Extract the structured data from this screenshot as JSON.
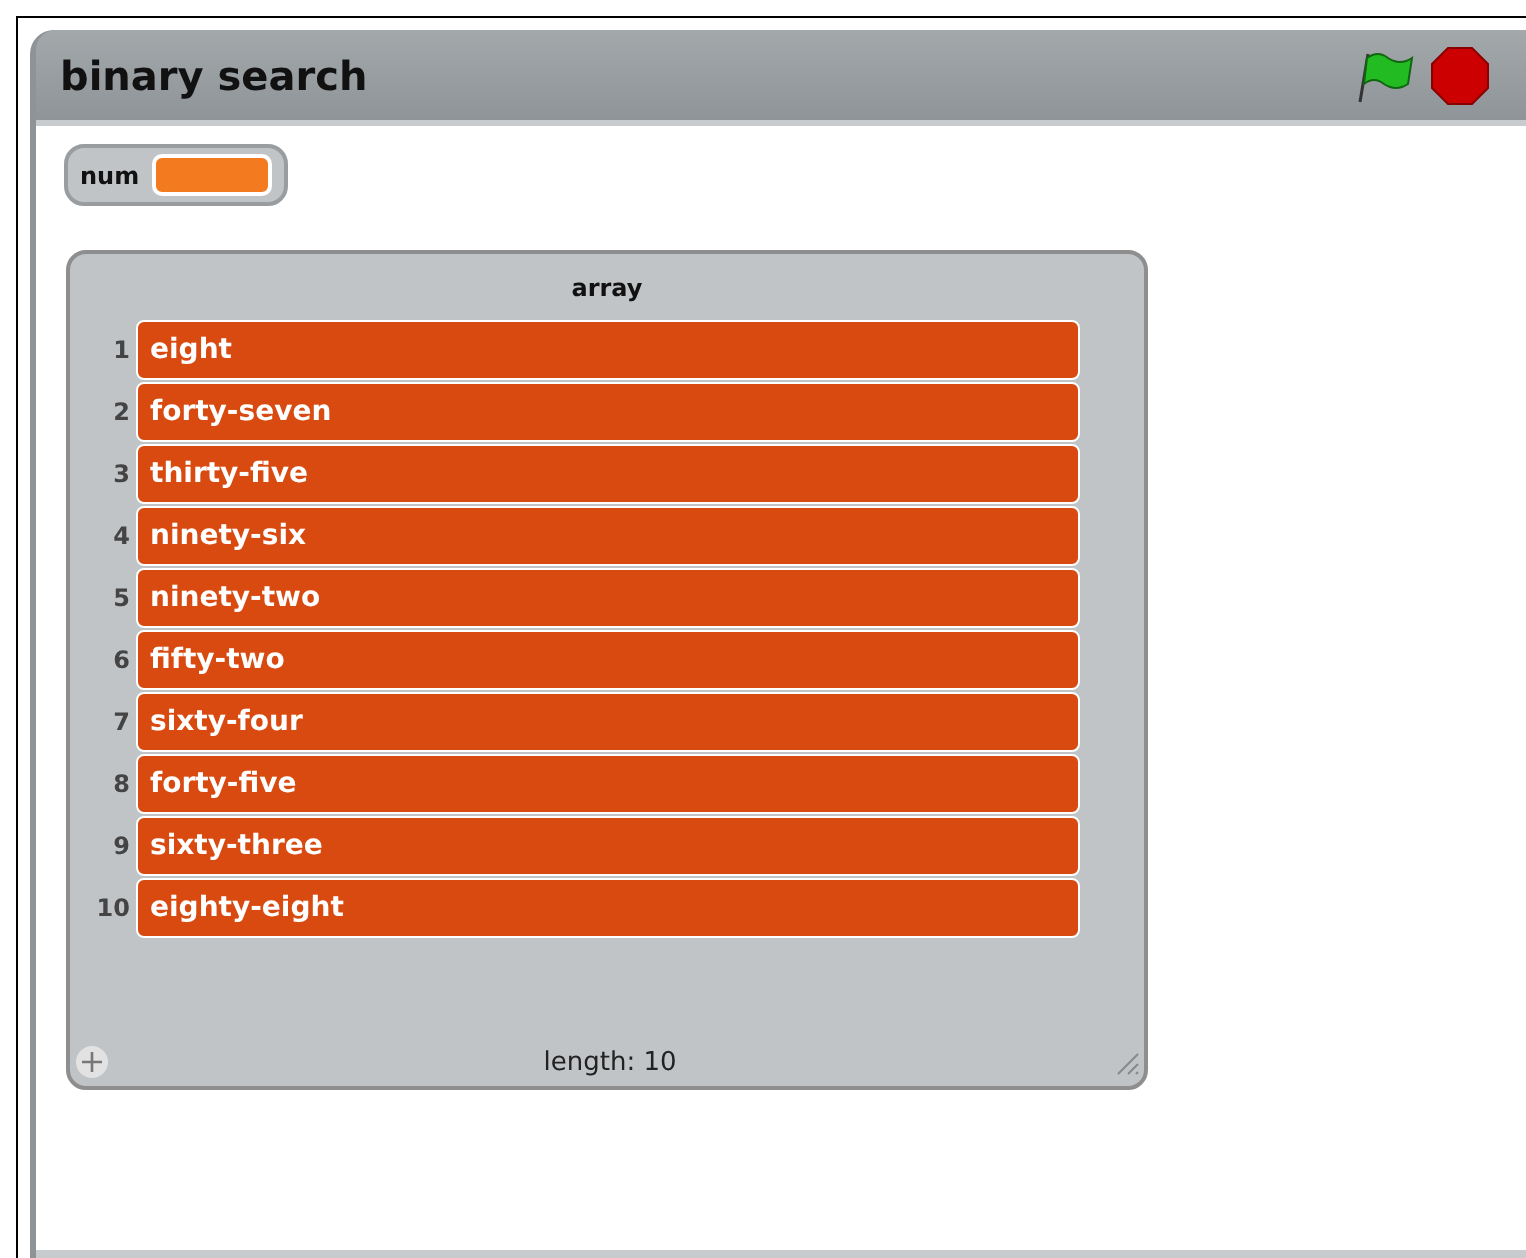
{
  "window": {
    "title": "binary search"
  },
  "variable": {
    "name": "num"
  },
  "list": {
    "title": "array",
    "items": [
      {
        "index": "1",
        "value": "eight"
      },
      {
        "index": "2",
        "value": "forty-seven"
      },
      {
        "index": "3",
        "value": "thirty-five"
      },
      {
        "index": "4",
        "value": "ninety-six"
      },
      {
        "index": "5",
        "value": "ninety-two"
      },
      {
        "index": "6",
        "value": "fifty-two"
      },
      {
        "index": "7",
        "value": "sixty-four"
      },
      {
        "index": "8",
        "value": "forty-five"
      },
      {
        "index": "9",
        "value": "sixty-three"
      },
      {
        "index": "10",
        "value": "eighty-eight"
      }
    ],
    "length_label": "length: 10"
  }
}
